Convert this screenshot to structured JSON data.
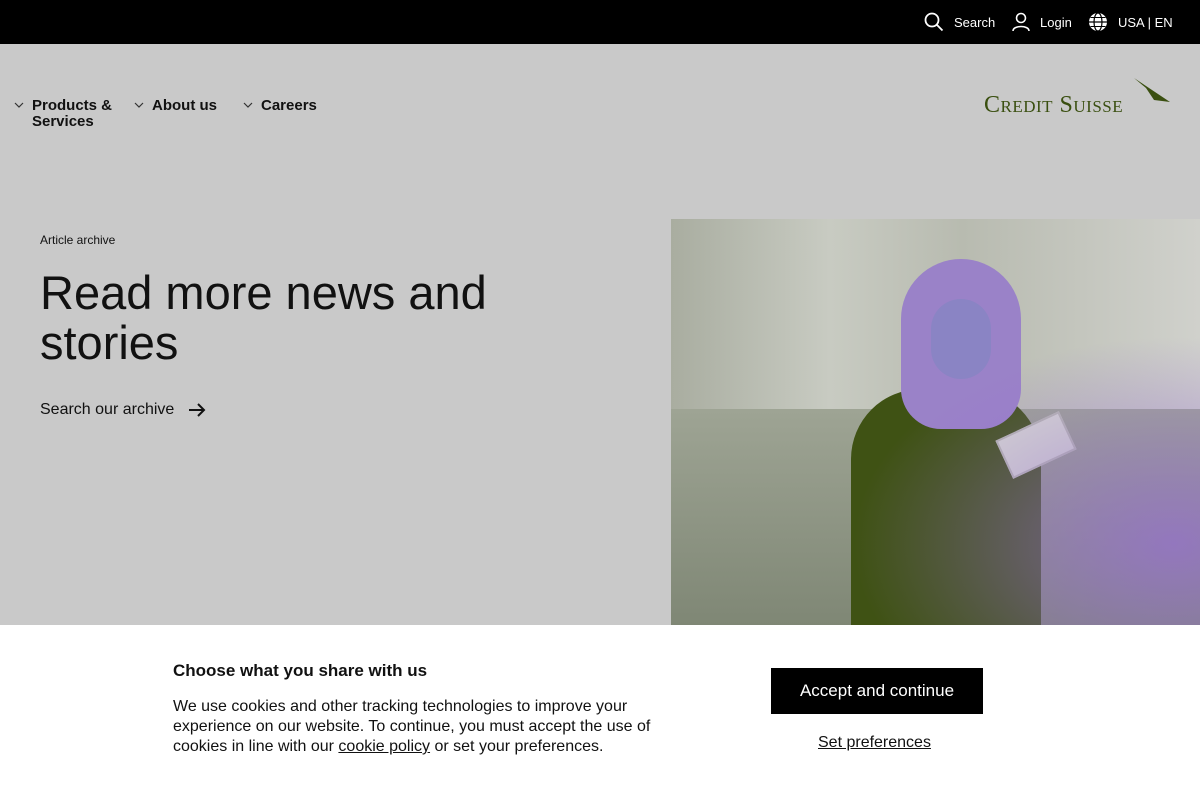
{
  "topbar": {
    "search_label": "Search",
    "login_label": "Login",
    "language_label": "USA | EN"
  },
  "nav": {
    "items": [
      {
        "label": "Products & Services"
      },
      {
        "label": "About us"
      },
      {
        "label": "Careers"
      }
    ]
  },
  "logo": {
    "text": "Credit Suisse"
  },
  "hero": {
    "eyebrow": "Article archive",
    "title": "Read more news and stories",
    "link_label": "Search our archive"
  },
  "cookie_banner": {
    "title": "Choose what you share with us",
    "text_before": "We use cookies and other tracking technologies to improve your experience on our website. To continue, you must accept the use of cookies in line with our ",
    "policy_link": "cookie policy",
    "text_after": " or set your preferences.",
    "accept_label": "Accept and continue",
    "preferences_label": "Set preferences"
  },
  "colors": {
    "topbar_bg": "#000000",
    "page_bg": "#c9c9c9",
    "brand_green": "#3a4f10",
    "banner_bg": "#ffffff"
  }
}
